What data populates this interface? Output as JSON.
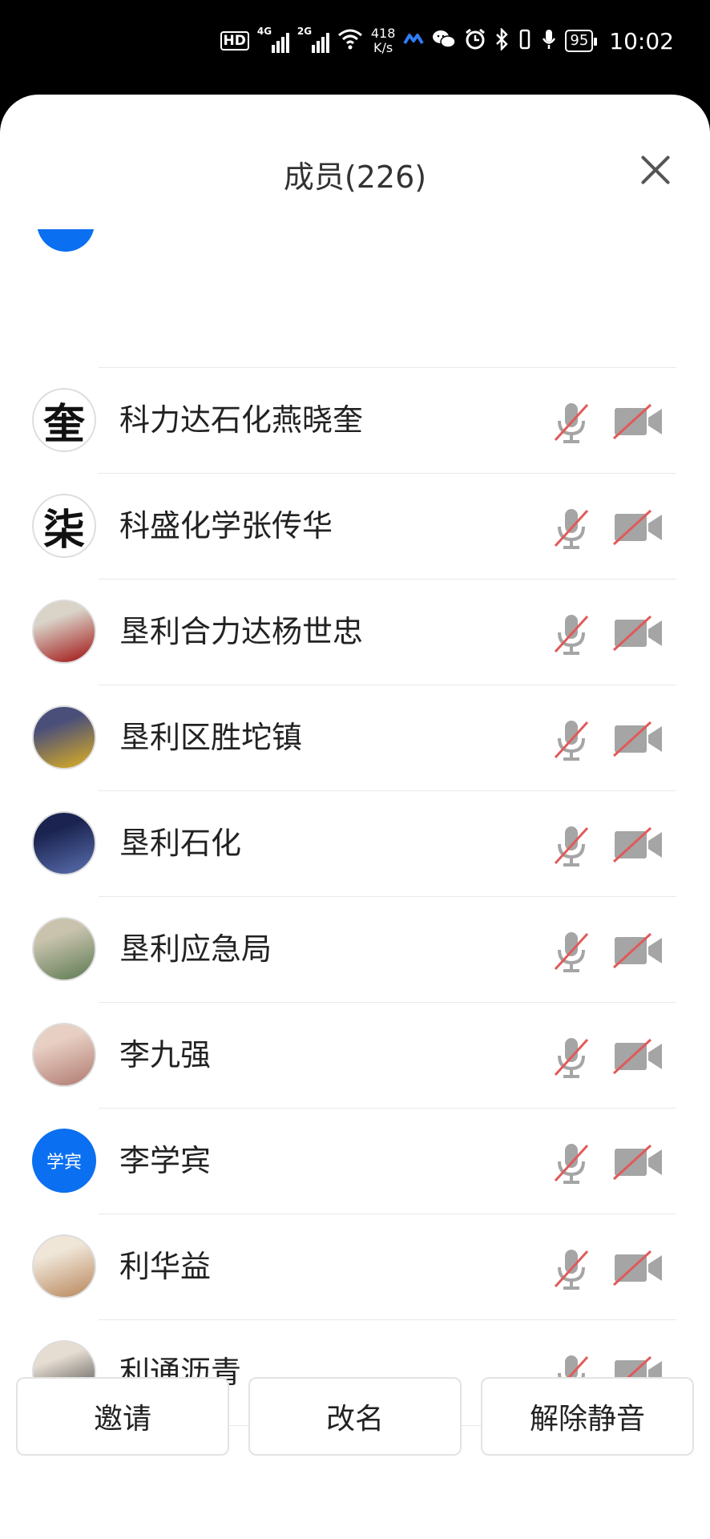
{
  "status_bar": {
    "hd": "HD",
    "net1": "4G",
    "net2": "2G",
    "speed_value": "418",
    "speed_unit": "K/s",
    "battery": "95",
    "time": "10:02"
  },
  "header": {
    "title": "成员(226)"
  },
  "members": [
    {
      "name": "科力达石化燕晓奎",
      "avatar_type": "glyph",
      "avatar_text": "奎",
      "avatar_colors": [
        "#ffffff",
        "#ffffff"
      ]
    },
    {
      "name": "科盛化学张传华",
      "avatar_type": "glyph",
      "avatar_text": "柒",
      "avatar_colors": [
        "#ffffff",
        "#ffffff"
      ]
    },
    {
      "name": "垦利合力达杨世忠",
      "avatar_type": "photo",
      "avatar_text": "",
      "avatar_colors": [
        "#d9d3c8",
        "#a01010"
      ]
    },
    {
      "name": "垦利区胜坨镇",
      "avatar_type": "photo",
      "avatar_text": "",
      "avatar_colors": [
        "#4a4f7a",
        "#e0b020"
      ]
    },
    {
      "name": "垦利石化",
      "avatar_type": "photo",
      "avatar_text": "",
      "avatar_colors": [
        "#1b2450",
        "#5a6fb0"
      ]
    },
    {
      "name": "垦利应急局",
      "avatar_type": "photo",
      "avatar_text": "",
      "avatar_colors": [
        "#c9c3ae",
        "#5c7a52"
      ]
    },
    {
      "name": "李九强",
      "avatar_type": "photo",
      "avatar_text": "",
      "avatar_colors": [
        "#e8cfc4",
        "#b07a70"
      ]
    },
    {
      "name": "李学宾",
      "avatar_type": "text",
      "avatar_text": "学宾",
      "avatar_colors": [
        "#0a6ff0",
        "#0a6ff0"
      ]
    },
    {
      "name": "利华益",
      "avatar_type": "photo",
      "avatar_text": "",
      "avatar_colors": [
        "#efe6d8",
        "#b8865a"
      ]
    },
    {
      "name": "利通沥青",
      "avatar_type": "photo",
      "avatar_text": "",
      "avatar_colors": [
        "#e6ddd2",
        "#3a3a3a"
      ]
    }
  ],
  "actions": {
    "invite": "邀请",
    "rename": "改名",
    "unmute": "解除静音"
  },
  "colors": {
    "accent": "#0a6ff0",
    "icon_gray": "#a5a5a5",
    "strike_red": "#e05a5a"
  }
}
